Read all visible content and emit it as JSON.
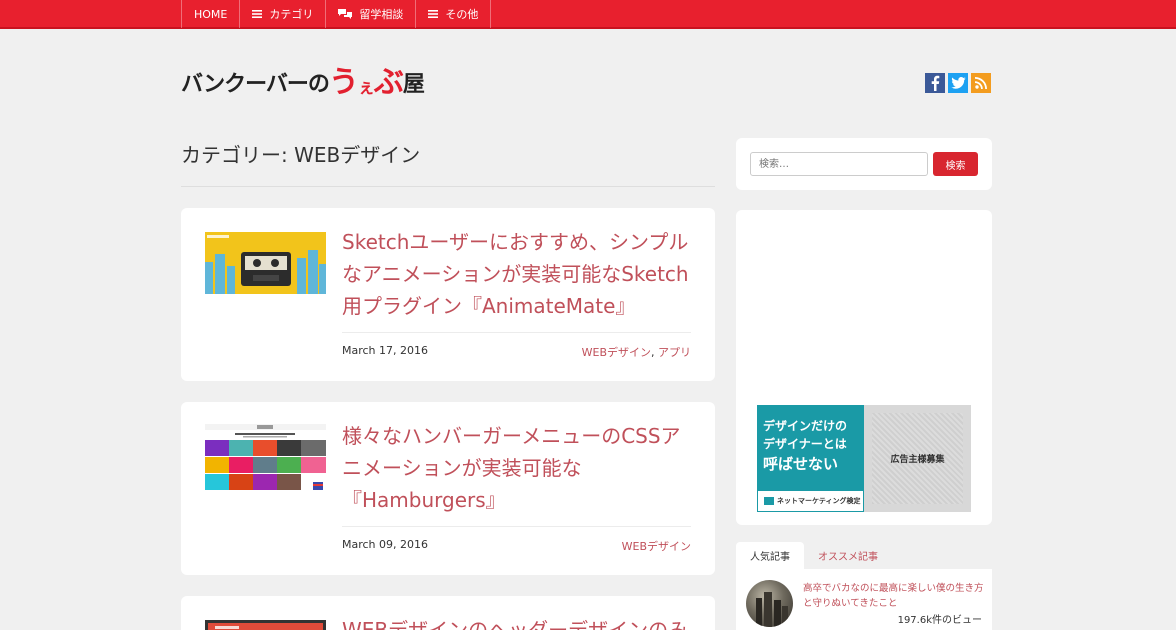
{
  "nav": {
    "items": [
      {
        "label": "HOME",
        "icon": ""
      },
      {
        "label": "カテゴリ",
        "icon": "menu-icon"
      },
      {
        "label": "留学相談",
        "icon": "chat-icon"
      },
      {
        "label": "その他",
        "icon": "menu-icon"
      }
    ]
  },
  "header": {
    "logo_part1": "バンクーバーの",
    "logo_u": "う",
    "logo_e": "ぇ",
    "logo_bu": "ぶ",
    "logo_ya": "屋",
    "social": {
      "facebook": "f",
      "twitter": "t",
      "rss": "rss"
    }
  },
  "page": {
    "category_title": "カテゴリー: WEBデザイン"
  },
  "posts": [
    {
      "title": "Sketchユーザーにおすすめ、シンプルなアニメーションが実装可能なSketch用プラグイン『AnimateMate』",
      "date": "March 17, 2016",
      "categories": [
        "WEBデザイン",
        ", ",
        "アプリ"
      ]
    },
    {
      "title": "様々なハンバーガーメニューのCSSアニメーションが実装可能な『Hamburgers』",
      "date": "March 09, 2016",
      "categories": [
        "WEBデザイン"
      ]
    },
    {
      "title": "WEBデザインのヘッダーデザインのみ",
      "date": "",
      "categories": []
    }
  ],
  "sidebar": {
    "search_placeholder": "検索…",
    "search_button": "検索",
    "ad": {
      "line1": "デザインだけの",
      "line2": "デザイナーとは",
      "line3": "呼ばせない",
      "footer": "ネットマーケティング検定",
      "right": "広告主様募集"
    },
    "tabs": [
      "人気記事",
      "オススメ記事"
    ],
    "popular": {
      "title": "高卒でバカなのに最高に楽しい僕の生き方と守りぬいてきたこと",
      "views": "197.6k件のビュー"
    }
  },
  "colors": {
    "nav_bg": "#e8202e",
    "accent": "#c0505a",
    "search_button": "#d8262f"
  }
}
